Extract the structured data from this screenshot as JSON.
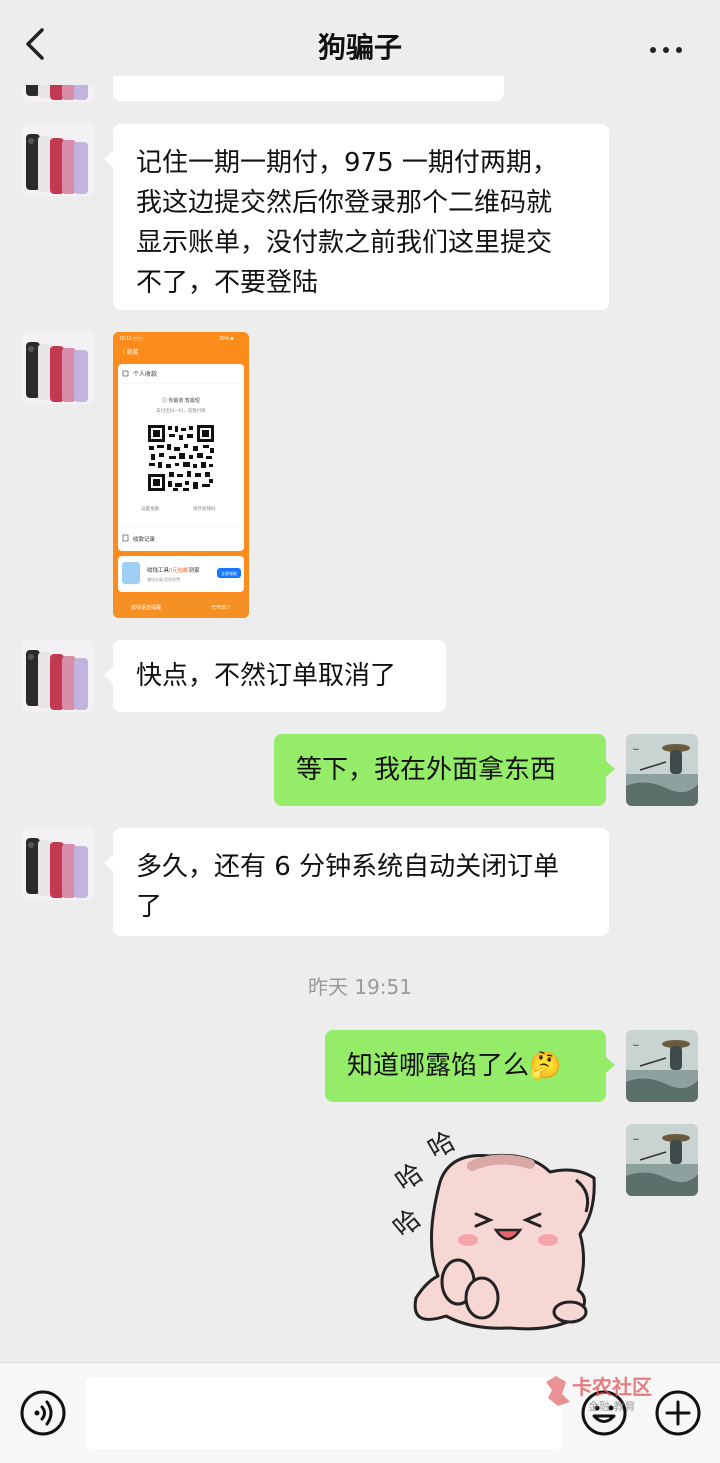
{
  "header": {
    "title": "狗骗子",
    "back_icon": "chevron-left-icon",
    "more_icon": "more-dots-icon"
  },
  "messages": [
    {
      "side": "left",
      "type": "text",
      "text_lines": [
        "记住一期一期付，975 一期付两期，",
        "我这边提交然后你登录那个二维码就",
        "显示账单，没付款之前我们这里提交",
        "不了，不要登陆"
      ]
    },
    {
      "side": "left",
      "type": "image",
      "image_desc": "payment-qr-screenshot",
      "screenshot_text": {
        "status_time": "19:16 ⓤⓝ",
        "status_right": "30% ■",
        "nav_back": "〈 收款",
        "card_title": "个人收款",
        "account_line": "◎ 你最收 暂最短",
        "scan_hint": "支付宝扫一扫，向我付款",
        "set_amount": "设置金额",
        "save_code": "保存收钱码",
        "records": "收款记录",
        "promo_text_a": "收钱工具",
        "promo_text_b": "0元包邮",
        "promo_text_c": "到家",
        "promo_sub": "赚钱必备 提现免费",
        "promo_btn": "立即领取",
        "bottom_left": "收钱语音提醒",
        "bottom_right": "已开启 〉"
      }
    },
    {
      "side": "left",
      "type": "text",
      "text_lines": [
        "快点，不然订单取消了"
      ]
    },
    {
      "side": "right",
      "type": "text",
      "text_lines": [
        "等下，我在外面拿东西"
      ]
    },
    {
      "side": "left",
      "type": "text",
      "text_lines": [
        "多久，还有 6 分钟系统自动关闭订单",
        "了"
      ]
    },
    {
      "side": "right",
      "type": "text",
      "text_lines": [
        "知道哪露馅了么🤔"
      ]
    },
    {
      "side": "right",
      "type": "sticker",
      "sticker_desc": "laughing-cat-sticker",
      "sticker_text": [
        "哈",
        "哈",
        "哈"
      ]
    }
  ],
  "timestamp": "昨天 19:51",
  "bottom_bar": {
    "voice_icon": "voice-icon",
    "emoji_icon": "emoji-icon",
    "plus_icon": "plus-icon",
    "watermark": "卡农社区",
    "watermark_sub": "金融 教育"
  },
  "colors": {
    "background": "#ededed",
    "bubble_left": "#ffffff",
    "bubble_right": "#95ec69",
    "qr_orange": "#fb8c1c",
    "watermark_red": "#e0555a"
  }
}
